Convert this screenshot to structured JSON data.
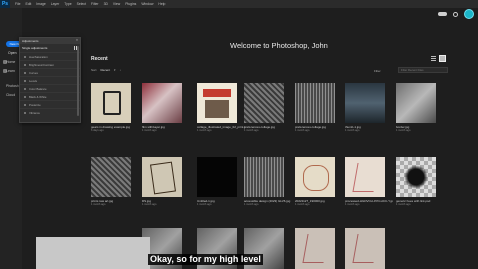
{
  "app": {
    "logo": "Ps"
  },
  "menubar": {
    "items": [
      "File",
      "Edit",
      "Image",
      "Layer",
      "Type",
      "Select",
      "Filter",
      "3D",
      "View",
      "Plugins",
      "Window",
      "Help"
    ]
  },
  "sidebar": {
    "new_file": "New file",
    "open": "Open",
    "nav": [
      "Home",
      "Learn",
      "Photoshop",
      "Cloud"
    ]
  },
  "learn_panel": {
    "title": "Adjustments",
    "subtitle": "Single adjustments",
    "rows": [
      "Hue/Saturation",
      "Brightness/Contrast",
      "Curves",
      "Levels",
      "Color Balance",
      "Black & White",
      "Posterize",
      "Vibrance"
    ]
  },
  "main": {
    "welcome": "Welcome to Photoshop, John",
    "recent_heading": "Recent",
    "sort_label": "Sort",
    "sort_value": "Recent",
    "filter_label": "Filter",
    "filter_placeholder": "Filter Recent Files"
  },
  "files": [
    {
      "name": "gears in drawing example.jpg",
      "meta": "6 days ago"
    },
    {
      "name": "film still.bayer.jpg",
      "meta": "1 month ago"
    },
    {
      "name": "collage_illustrated_image_02_print.jpg",
      "meta": "1 month ago"
    },
    {
      "name": "preferences.collage.jpg",
      "meta": "1 month ago"
    },
    {
      "name": "preferences.collage.jpg",
      "meta": "1 month ago"
    },
    {
      "name": "thumb-1.jpg",
      "meta": "1 month ago"
    },
    {
      "name": "border.jpg",
      "meta": "1 month ago"
    },
    {
      "name": "prints raw art.jpg",
      "meta": "1 month ago"
    },
    {
      "name": "DS.jpg",
      "meta": "1 month ago"
    },
    {
      "name": "Untitled-1.jpg",
      "meta": "1 month ago"
    },
    {
      "name": "accessible design (2023) GLV6.jpg",
      "meta": "1 month ago"
    },
    {
      "name": "20221127_190000.jpg",
      "meta": "1 month ago"
    },
    {
      "name": "processed-HGDVCH-0YD-HCC-Y.jpg",
      "meta": "1 month ago"
    },
    {
      "name": "generic hues with link.psd",
      "meta": "1 month ago"
    }
  ],
  "caption": {
    "text": "Okay, so for my high level"
  }
}
